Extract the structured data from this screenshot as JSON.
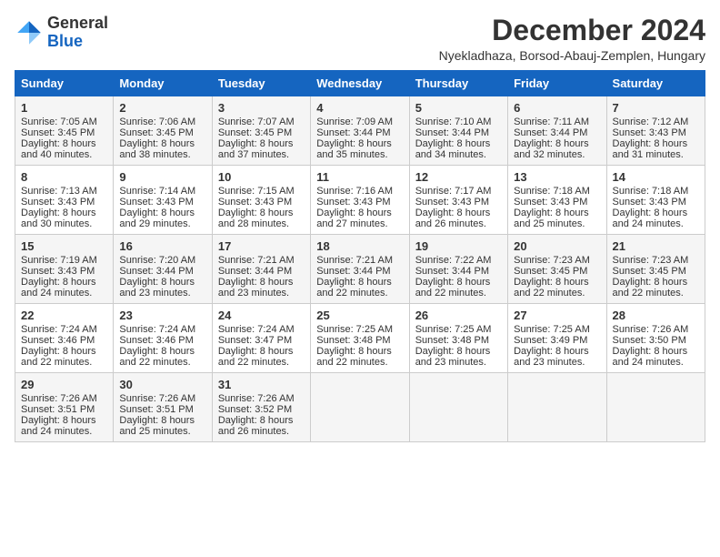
{
  "logo": {
    "general": "General",
    "blue": "Blue"
  },
  "title": "December 2024",
  "subtitle": "Nyekladhaza, Borsod-Abauj-Zemplen, Hungary",
  "headers": [
    "Sunday",
    "Monday",
    "Tuesday",
    "Wednesday",
    "Thursday",
    "Friday",
    "Saturday"
  ],
  "weeks": [
    [
      {
        "day": "1",
        "sunrise": "Sunrise: 7:05 AM",
        "sunset": "Sunset: 3:45 PM",
        "daylight": "Daylight: 8 hours and 40 minutes."
      },
      {
        "day": "2",
        "sunrise": "Sunrise: 7:06 AM",
        "sunset": "Sunset: 3:45 PM",
        "daylight": "Daylight: 8 hours and 38 minutes."
      },
      {
        "day": "3",
        "sunrise": "Sunrise: 7:07 AM",
        "sunset": "Sunset: 3:45 PM",
        "daylight": "Daylight: 8 hours and 37 minutes."
      },
      {
        "day": "4",
        "sunrise": "Sunrise: 7:09 AM",
        "sunset": "Sunset: 3:44 PM",
        "daylight": "Daylight: 8 hours and 35 minutes."
      },
      {
        "day": "5",
        "sunrise": "Sunrise: 7:10 AM",
        "sunset": "Sunset: 3:44 PM",
        "daylight": "Daylight: 8 hours and 34 minutes."
      },
      {
        "day": "6",
        "sunrise": "Sunrise: 7:11 AM",
        "sunset": "Sunset: 3:44 PM",
        "daylight": "Daylight: 8 hours and 32 minutes."
      },
      {
        "day": "7",
        "sunrise": "Sunrise: 7:12 AM",
        "sunset": "Sunset: 3:43 PM",
        "daylight": "Daylight: 8 hours and 31 minutes."
      }
    ],
    [
      {
        "day": "8",
        "sunrise": "Sunrise: 7:13 AM",
        "sunset": "Sunset: 3:43 PM",
        "daylight": "Daylight: 8 hours and 30 minutes."
      },
      {
        "day": "9",
        "sunrise": "Sunrise: 7:14 AM",
        "sunset": "Sunset: 3:43 PM",
        "daylight": "Daylight: 8 hours and 29 minutes."
      },
      {
        "day": "10",
        "sunrise": "Sunrise: 7:15 AM",
        "sunset": "Sunset: 3:43 PM",
        "daylight": "Daylight: 8 hours and 28 minutes."
      },
      {
        "day": "11",
        "sunrise": "Sunrise: 7:16 AM",
        "sunset": "Sunset: 3:43 PM",
        "daylight": "Daylight: 8 hours and 27 minutes."
      },
      {
        "day": "12",
        "sunrise": "Sunrise: 7:17 AM",
        "sunset": "Sunset: 3:43 PM",
        "daylight": "Daylight: 8 hours and 26 minutes."
      },
      {
        "day": "13",
        "sunrise": "Sunrise: 7:18 AM",
        "sunset": "Sunset: 3:43 PM",
        "daylight": "Daylight: 8 hours and 25 minutes."
      },
      {
        "day": "14",
        "sunrise": "Sunrise: 7:18 AM",
        "sunset": "Sunset: 3:43 PM",
        "daylight": "Daylight: 8 hours and 24 minutes."
      }
    ],
    [
      {
        "day": "15",
        "sunrise": "Sunrise: 7:19 AM",
        "sunset": "Sunset: 3:43 PM",
        "daylight": "Daylight: 8 hours and 24 minutes."
      },
      {
        "day": "16",
        "sunrise": "Sunrise: 7:20 AM",
        "sunset": "Sunset: 3:44 PM",
        "daylight": "Daylight: 8 hours and 23 minutes."
      },
      {
        "day": "17",
        "sunrise": "Sunrise: 7:21 AM",
        "sunset": "Sunset: 3:44 PM",
        "daylight": "Daylight: 8 hours and 23 minutes."
      },
      {
        "day": "18",
        "sunrise": "Sunrise: 7:21 AM",
        "sunset": "Sunset: 3:44 PM",
        "daylight": "Daylight: 8 hours and 22 minutes."
      },
      {
        "day": "19",
        "sunrise": "Sunrise: 7:22 AM",
        "sunset": "Sunset: 3:44 PM",
        "daylight": "Daylight: 8 hours and 22 minutes."
      },
      {
        "day": "20",
        "sunrise": "Sunrise: 7:23 AM",
        "sunset": "Sunset: 3:45 PM",
        "daylight": "Daylight: 8 hours and 22 minutes."
      },
      {
        "day": "21",
        "sunrise": "Sunrise: 7:23 AM",
        "sunset": "Sunset: 3:45 PM",
        "daylight": "Daylight: 8 hours and 22 minutes."
      }
    ],
    [
      {
        "day": "22",
        "sunrise": "Sunrise: 7:24 AM",
        "sunset": "Sunset: 3:46 PM",
        "daylight": "Daylight: 8 hours and 22 minutes."
      },
      {
        "day": "23",
        "sunrise": "Sunrise: 7:24 AM",
        "sunset": "Sunset: 3:46 PM",
        "daylight": "Daylight: 8 hours and 22 minutes."
      },
      {
        "day": "24",
        "sunrise": "Sunrise: 7:24 AM",
        "sunset": "Sunset: 3:47 PM",
        "daylight": "Daylight: 8 hours and 22 minutes."
      },
      {
        "day": "25",
        "sunrise": "Sunrise: 7:25 AM",
        "sunset": "Sunset: 3:48 PM",
        "daylight": "Daylight: 8 hours and 22 minutes."
      },
      {
        "day": "26",
        "sunrise": "Sunrise: 7:25 AM",
        "sunset": "Sunset: 3:48 PM",
        "daylight": "Daylight: 8 hours and 23 minutes."
      },
      {
        "day": "27",
        "sunrise": "Sunrise: 7:25 AM",
        "sunset": "Sunset: 3:49 PM",
        "daylight": "Daylight: 8 hours and 23 minutes."
      },
      {
        "day": "28",
        "sunrise": "Sunrise: 7:26 AM",
        "sunset": "Sunset: 3:50 PM",
        "daylight": "Daylight: 8 hours and 24 minutes."
      }
    ],
    [
      {
        "day": "29",
        "sunrise": "Sunrise: 7:26 AM",
        "sunset": "Sunset: 3:51 PM",
        "daylight": "Daylight: 8 hours and 24 minutes."
      },
      {
        "day": "30",
        "sunrise": "Sunrise: 7:26 AM",
        "sunset": "Sunset: 3:51 PM",
        "daylight": "Daylight: 8 hours and 25 minutes."
      },
      {
        "day": "31",
        "sunrise": "Sunrise: 7:26 AM",
        "sunset": "Sunset: 3:52 PM",
        "daylight": "Daylight: 8 hours and 26 minutes."
      },
      null,
      null,
      null,
      null
    ]
  ]
}
